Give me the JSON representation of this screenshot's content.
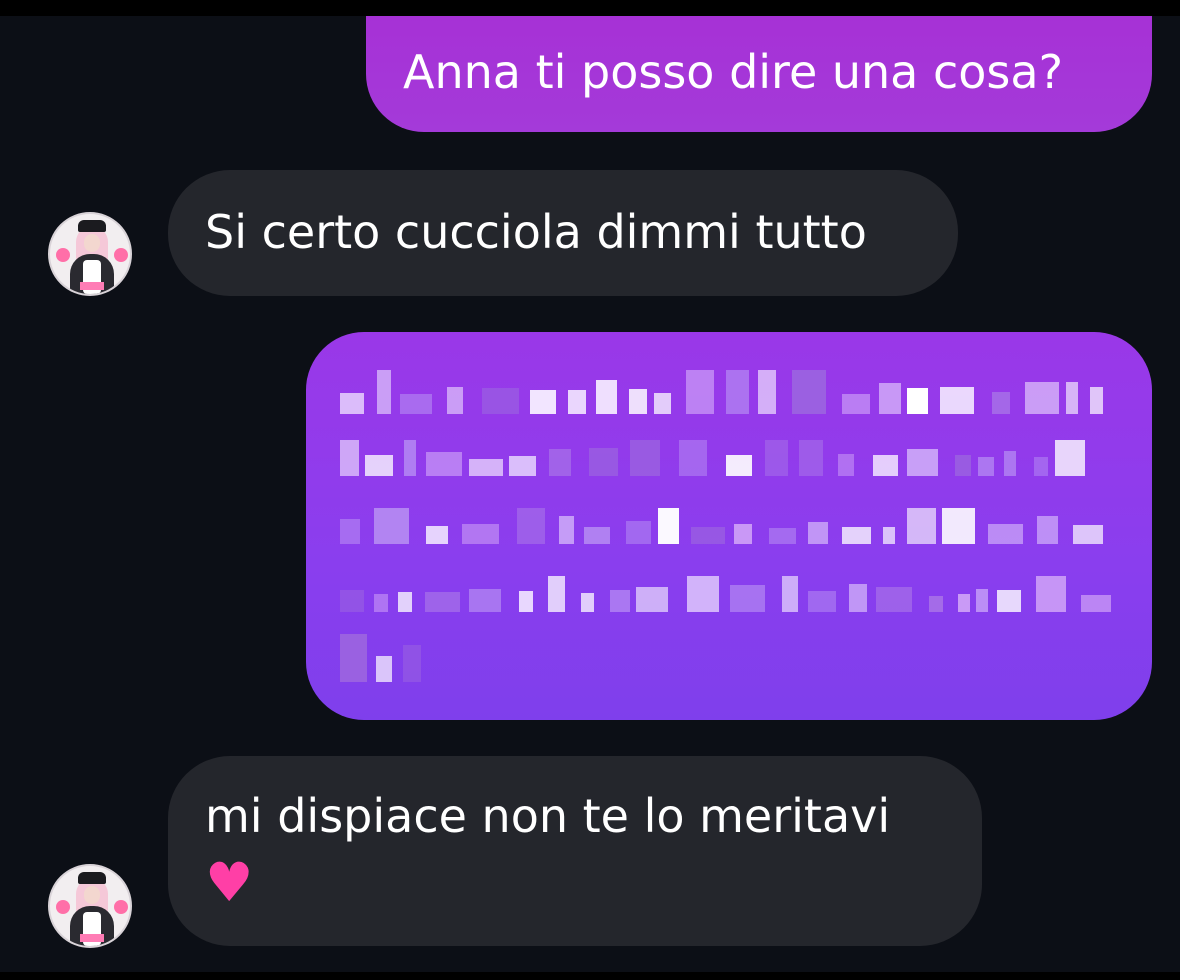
{
  "messages": [
    {
      "direction": "outgoing",
      "text": "Anna ti posso dire una cosa?"
    },
    {
      "direction": "incoming",
      "text": "Si certo cucciola dimmi tutto"
    },
    {
      "direction": "outgoing",
      "text": "",
      "note_hidden": true
    },
    {
      "direction": "incoming",
      "text": "mi dispiace non te lo meritavi",
      "emoji": "♥"
    }
  ],
  "colors": {
    "background": "#0c0f16",
    "outgoing_bubble": "#9a38e8",
    "incoming_bubble": "#24262c",
    "text": "#ffffff",
    "heart": "#ff3fa6"
  },
  "icons": {
    "avatar": "contact-avatar",
    "heart": "pink-heart-emoji"
  }
}
